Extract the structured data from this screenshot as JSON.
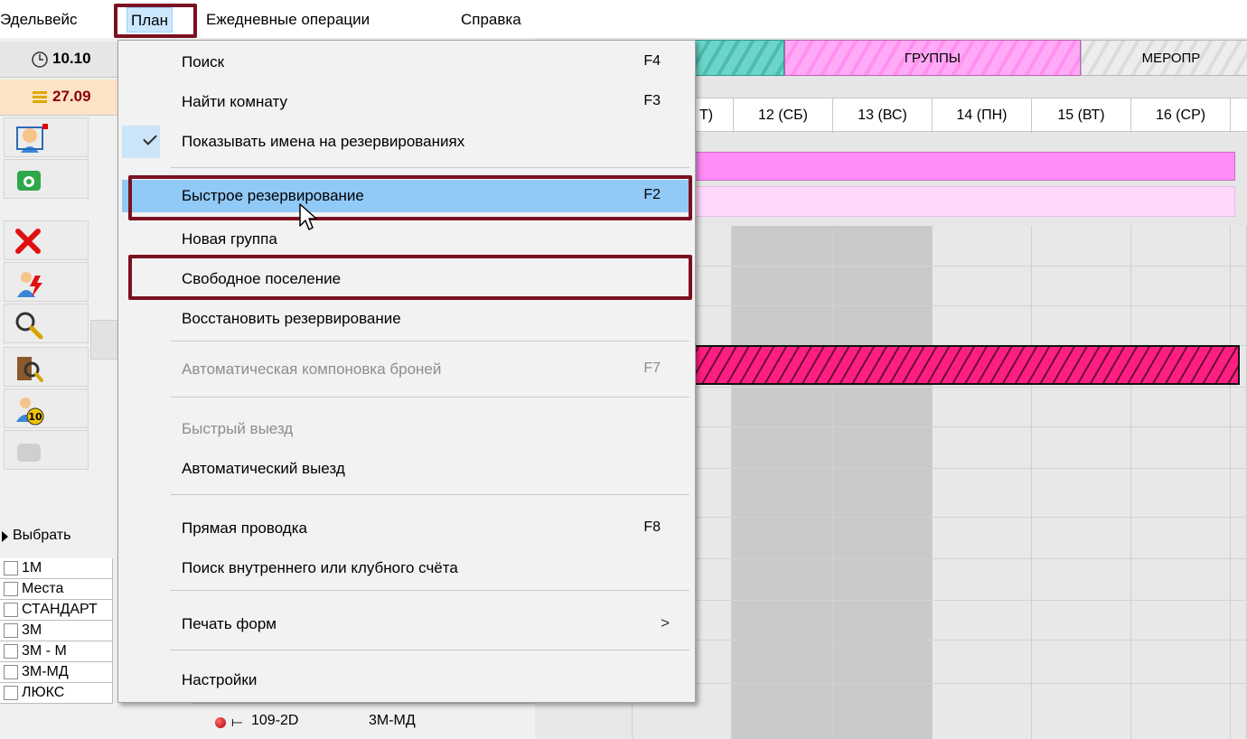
{
  "menubar": {
    "items": [
      "Эдельвейс",
      "План",
      "Ежедневные операции",
      "Справка"
    ],
    "active_index": 1
  },
  "left_panel": {
    "time": "10.10",
    "date": "27.09",
    "choose_label": "Выбрать",
    "room_types": [
      "1М",
      "Места",
      "СТАНДАРТ",
      "3М",
      "3М - М",
      "3М-МД",
      "ЛЮКС"
    ]
  },
  "room_row": {
    "number": "109-2D",
    "type": "3М-МД"
  },
  "tabs": [
    "ГРУППЫ",
    "МЕРОПР"
  ],
  "dates": [
    "Т)",
    "12 (СБ)",
    "13 (ВС)",
    "14 (ПН)",
    "15 (ВТ)",
    "16 (СР)"
  ],
  "menu": {
    "items": [
      {
        "label": "Поиск",
        "shortcut": "F4"
      },
      {
        "label": "Найти комнату",
        "shortcut": "F3"
      },
      {
        "label": "Показывать имена на резервированиях",
        "shortcut": "",
        "checked": true
      },
      {
        "label": "Быстрое резервирование",
        "shortcut": "F2",
        "highlighted": true
      },
      {
        "label": "Новая группа",
        "shortcut": ""
      },
      {
        "label": "Свободное поселение",
        "shortcut": ""
      },
      {
        "label": "Восстановить резервирование",
        "shortcut": ""
      },
      {
        "label": "Автоматическая компоновка броней",
        "shortcut": "F7",
        "disabled": true
      },
      {
        "label": "Быстрый выезд",
        "shortcut": "",
        "disabled": true
      },
      {
        "label": "Автоматический выезд",
        "shortcut": ""
      },
      {
        "label": "Прямая проводка",
        "shortcut": "F8"
      },
      {
        "label": "Поиск внутреннего или клубного счёта",
        "shortcut": ""
      },
      {
        "label": "Печать форм",
        "shortcut": "",
        "submenu_arrow": ">"
      },
      {
        "label": "Настройки",
        "shortcut": ""
      }
    ]
  },
  "colors": {
    "frame": "#7b1120",
    "menu_highlight": "#91c9f7",
    "group_band": "#ff8cf7",
    "reservation_bar": "#ff1e82"
  }
}
